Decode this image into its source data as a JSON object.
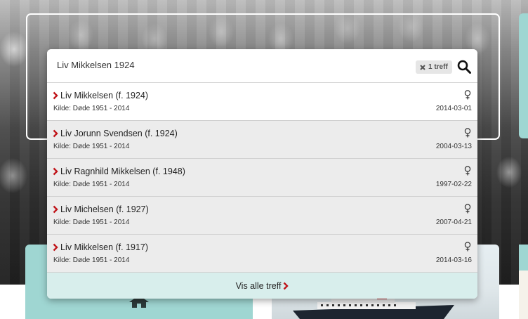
{
  "search": {
    "query": "Liv Mikkelsen 1924",
    "hits_label": "1 treff"
  },
  "results": [
    {
      "name": "Liv Mikkelsen (f. 1924)",
      "source": "Kilde: Døde 1951 - 2014",
      "date": "2014-03-01"
    },
    {
      "name": "Liv Jorunn Svendsen (f. 1924)",
      "source": "Kilde: Døde 1951 - 2014",
      "date": "2004-03-13"
    },
    {
      "name": "Liv Ragnhild Mikkelsen (f. 1948)",
      "source": "Kilde: Døde 1951 - 2014",
      "date": "1997-02-22"
    },
    {
      "name": "Liv Michelsen (f. 1927)",
      "source": "Kilde: Døde 1951 - 2014",
      "date": "2007-04-21"
    },
    {
      "name": "Liv Mikkelsen (f. 1917)",
      "source": "Kilde: Døde 1951 - 2014",
      "date": "2014-03-16"
    }
  ],
  "footer": {
    "show_all_label": "Vis alle treff"
  },
  "colors": {
    "accent_red": "#c0161b",
    "teal": "#9fd6d2",
    "row_alt": "#ececec",
    "footer_bg": "#d8eeec"
  },
  "icons": {
    "clear": "close-icon",
    "search": "search-icon",
    "row_marker": "chevron-right-icon",
    "gender": "female-icon",
    "card_left": "home-icon"
  }
}
